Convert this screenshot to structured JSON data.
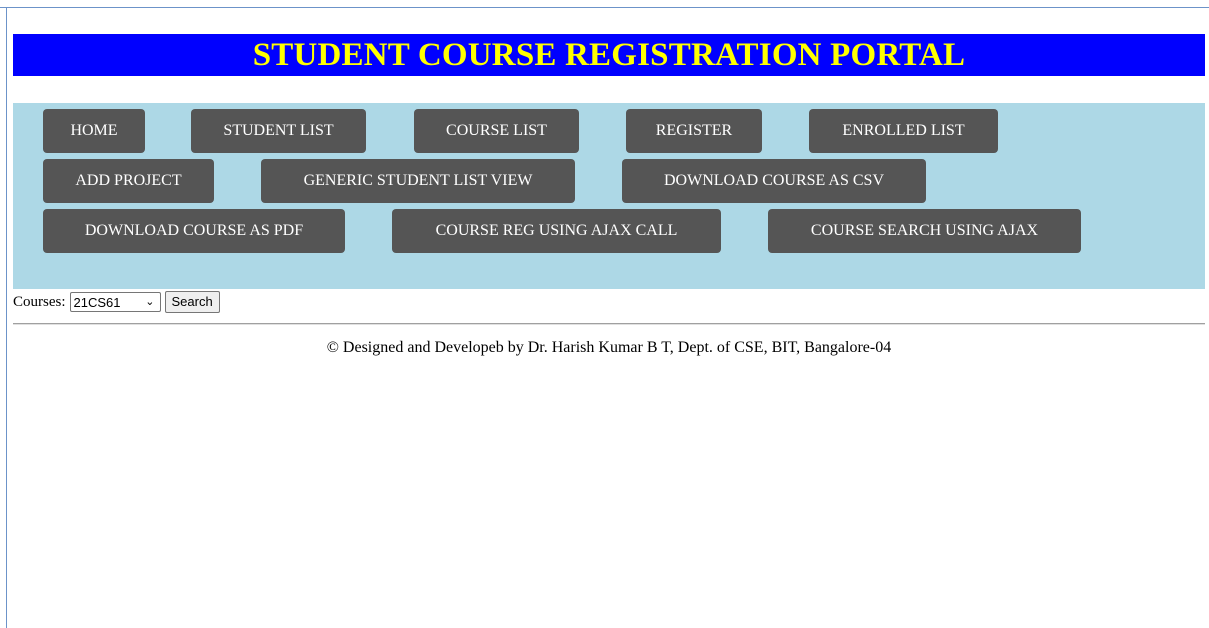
{
  "banner": {
    "title": "STUDENT COURSE REGISTRATION PORTAL",
    "background": "#0000ff",
    "text_color": "#ffff00"
  },
  "nav": {
    "background": "#add8e6",
    "button_color": "#555555",
    "items": [
      {
        "label": "HOME"
      },
      {
        "label": "STUDENT LIST"
      },
      {
        "label": "COURSE LIST"
      },
      {
        "label": "REGISTER"
      },
      {
        "label": "ENROLLED LIST"
      },
      {
        "label": "ADD PROJECT"
      },
      {
        "label": "GENERIC STUDENT LIST VIEW"
      },
      {
        "label": "DOWNLOAD COURSE AS CSV"
      },
      {
        "label": "DOWNLOAD COURSE AS PDF"
      },
      {
        "label": "COURSE REG USING AJAX CALL"
      },
      {
        "label": "COURSE SEARCH USING AJAX"
      }
    ]
  },
  "search": {
    "label": "Courses:",
    "selected_course": "21CS61",
    "button_label": "Search"
  },
  "footer": {
    "text": "© Designed and Developeb by Dr. Harish Kumar B T, Dept. of CSE, BIT, Bangalore-04"
  }
}
